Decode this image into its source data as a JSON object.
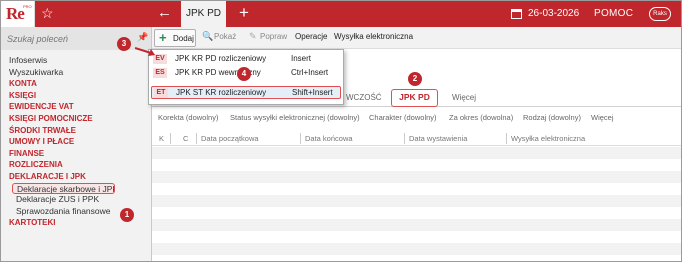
{
  "app": {
    "logo_text": "Re",
    "logo_sup": "PRO",
    "active_tab": "JPK PD",
    "date": "26-03-2026",
    "help_label": "POMOC",
    "cloud_label": "Raks"
  },
  "sidebar": {
    "search_placeholder": "Szukaj poleceń",
    "items": [
      {
        "label": "Infoserwis",
        "style": "plain"
      },
      {
        "label": "Wyszukiwarka",
        "style": "plain"
      },
      {
        "label": "KONTA",
        "style": "red"
      },
      {
        "label": "KSIĘGI",
        "style": "red"
      },
      {
        "label": "EWIDENCJE VAT",
        "style": "red"
      },
      {
        "label": "KSIĘGI POMOCNICZE",
        "style": "red"
      },
      {
        "label": "ŚRODKI TRWAŁE",
        "style": "red"
      },
      {
        "label": "UMOWY I PŁACE",
        "style": "red"
      },
      {
        "label": "FINANSE",
        "style": "red"
      },
      {
        "label": "ROZLICZENIA",
        "style": "red"
      },
      {
        "label": "DEKLARACJE I JPK",
        "style": "red"
      },
      {
        "label": "Deklaracje skarbowe i JPK",
        "style": "sel"
      },
      {
        "label": "Deklaracje ZUS i PPK",
        "style": "sub"
      },
      {
        "label": "Sprawozdania finansowe",
        "style": "sub"
      },
      {
        "label": "KARTOTEKI",
        "style": "red"
      }
    ]
  },
  "toolbar": {
    "add": "Dodaj",
    "show": "Pokaż",
    "correct": "Popraw",
    "operations": "Operacje",
    "send": "Wysyłka elektroniczna"
  },
  "dropdown": {
    "items": [
      {
        "code": "EV",
        "label": "JPK KR PD rozliczeniowy",
        "shortcut": "Insert"
      },
      {
        "code": "ES",
        "label": "JPK KR PD wewnętrzny",
        "shortcut": "Ctrl+Insert"
      },
      {
        "code": "ET",
        "label": "JPK ST KR rozliczeniowy",
        "shortcut": "Shift+Insert"
      }
    ]
  },
  "mode_tabs": {
    "partial": "WCZOŚĆ",
    "jpk_pd": "JPK PD",
    "more": "Więcej"
  },
  "filters": [
    "Korekta (dowolny)",
    "Status wysyłki elektronicznej (dowolny)",
    "Charakter (dowolny)",
    "Za okres (dowolna)",
    "Rodzaj (dowolny)",
    "Więcej"
  ],
  "grid": {
    "columns": [
      "K",
      "C",
      "Data początkowa",
      "Data końcowa",
      "Data wystawienia",
      "Wysyłka elektroniczna"
    ]
  },
  "callouts": [
    "1",
    "2",
    "3",
    "4"
  ],
  "colors": {
    "brand": "#c0272d",
    "highlight": "#e05050",
    "add_icon": "#2e8b57"
  }
}
